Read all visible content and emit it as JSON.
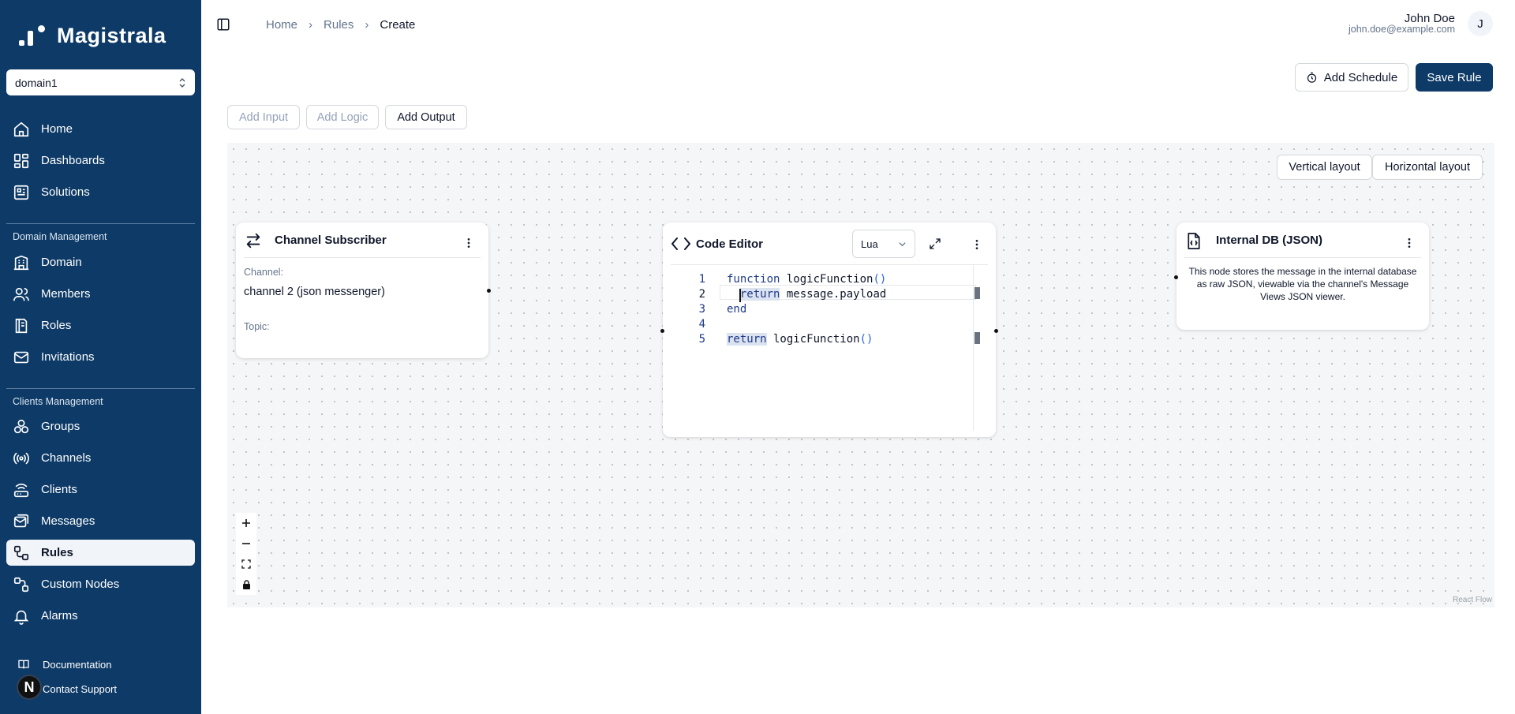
{
  "sidebar": {
    "brand": "Magistrala",
    "domain_select": "domain1",
    "main_items": [
      {
        "label": "Home",
        "icon": "home-icon"
      },
      {
        "label": "Dashboards",
        "icon": "dashboard-icon"
      },
      {
        "label": "Solutions",
        "icon": "solutions-icon"
      }
    ],
    "domain_section": "Domain Management",
    "domain_items": [
      {
        "label": "Domain",
        "icon": "building-icon"
      },
      {
        "label": "Members",
        "icon": "members-icon"
      },
      {
        "label": "Roles",
        "icon": "roles-icon"
      },
      {
        "label": "Invitations",
        "icon": "mail-icon"
      }
    ],
    "clients_section": "Clients Management",
    "clients_items": [
      {
        "label": "Groups",
        "icon": "groups-icon"
      },
      {
        "label": "Channels",
        "icon": "radio-icon"
      },
      {
        "label": "Clients",
        "icon": "router-icon"
      },
      {
        "label": "Messages",
        "icon": "messages-icon"
      },
      {
        "label": "Rules",
        "icon": "rules-icon",
        "active": true
      },
      {
        "label": "Custom Nodes",
        "icon": "custom-nodes-icon"
      },
      {
        "label": "Alarms",
        "icon": "bell-icon"
      }
    ],
    "footer": {
      "documentation": "Documentation",
      "support": "Contact Support",
      "avatar_initial": "N"
    }
  },
  "header": {
    "breadcrumb": [
      "Home",
      "Rules",
      "Create"
    ],
    "user_name": "John Doe",
    "user_email": "john.doe@example.com",
    "user_initial": "J"
  },
  "actions": {
    "add_schedule": "Add Schedule",
    "save_rule": "Save Rule",
    "add_input": "Add Input",
    "add_logic": "Add Logic",
    "add_output": "Add Output"
  },
  "canvas": {
    "vertical_layout": "Vertical layout",
    "horizontal_layout": "Horizontal layout",
    "attribution": "React Flow",
    "nodes": {
      "subscriber": {
        "title": "Channel Subscriber",
        "channel_label": "Channel:",
        "channel_value": "channel 2 (json messenger)",
        "topic_label": "Topic:"
      },
      "code_editor": {
        "title": "Code Editor",
        "language": "Lua",
        "lines": [
          {
            "n": "1",
            "text": "function logicFunction()"
          },
          {
            "n": "2",
            "text": "  return message.payload"
          },
          {
            "n": "3",
            "text": "end"
          },
          {
            "n": "4",
            "text": ""
          },
          {
            "n": "5",
            "text": "return logicFunction()"
          }
        ]
      },
      "output": {
        "title": "Internal DB (JSON)",
        "description": "This node stores the message in the internal database as raw JSON, viewable via the channel's Message Views JSON viewer."
      }
    }
  }
}
